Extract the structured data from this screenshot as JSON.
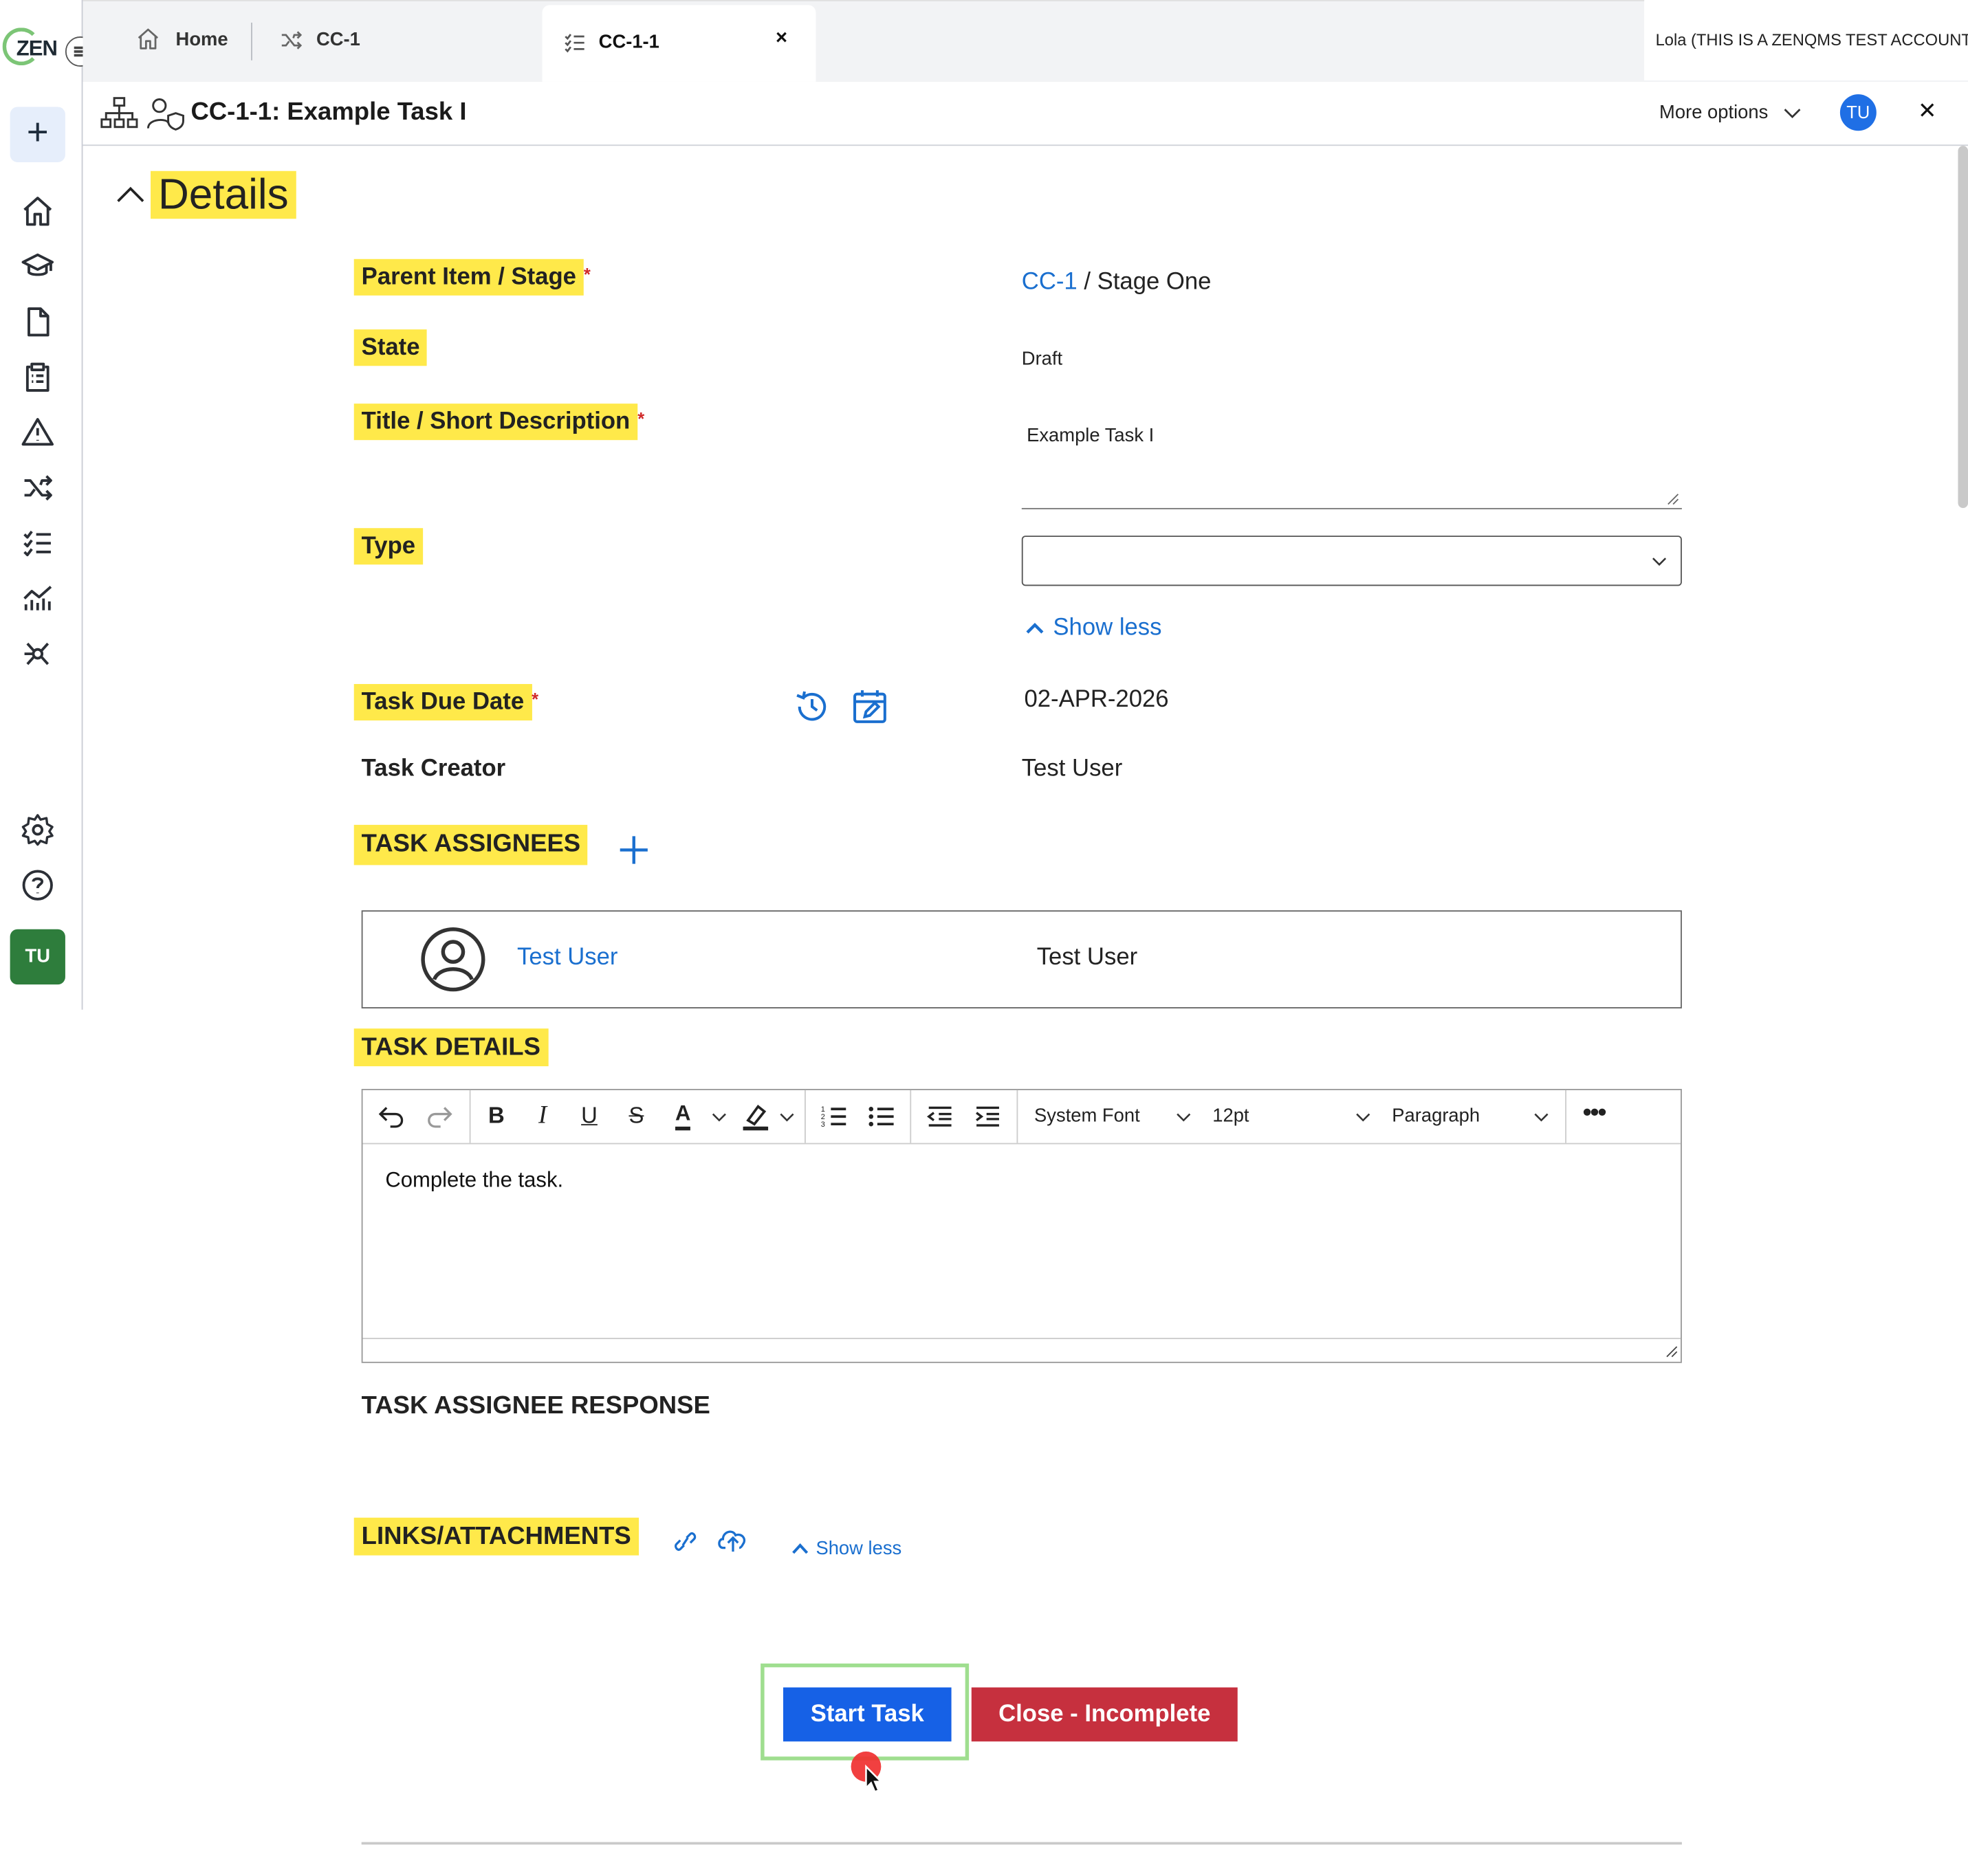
{
  "logo": {
    "text": "ZEN"
  },
  "tabs": [
    {
      "label": "Home",
      "icon": "home-icon"
    },
    {
      "label": "CC-1",
      "icon": "shuffle-icon"
    },
    {
      "label": "CC-1-1",
      "icon": "checklist-icon",
      "active": true
    }
  ],
  "account": {
    "label": "Lola (THIS IS A ZENQMS TEST ACCOUNT)"
  },
  "header": {
    "title": "CC-1-1: Example Task I",
    "more_options": "More options",
    "avatar": "TU"
  },
  "rail": {
    "avatar": "TU"
  },
  "section": {
    "title": "Details"
  },
  "fields": {
    "parent_label": "Parent Item / Stage",
    "parent_link": "CC-1",
    "parent_rest": " / Stage One",
    "state_label": "State",
    "state_value": "Draft",
    "title_label": "Title / Short Description",
    "title_value": "Example Task I",
    "type_label": "Type",
    "type_value": "",
    "show_less": "Show less",
    "due_label": "Task Due Date",
    "due_value": "02-APR-2026",
    "creator_label": "Task Creator",
    "creator_value": "Test User",
    "required_mark": "*"
  },
  "assignees": {
    "heading": "TASK ASSIGNEES",
    "rows": [
      {
        "name_link": "Test User",
        "name": "Test User"
      }
    ]
  },
  "task_details": {
    "heading": "TASK DETAILS",
    "font": "System Font",
    "size": "12pt",
    "block": "Paragraph",
    "body": "Complete the task."
  },
  "response": {
    "heading": "TASK ASSIGNEE RESPONSE"
  },
  "links": {
    "heading": "LINKS/ATTACHMENTS",
    "show_less": "Show less"
  },
  "actions": {
    "start": "Start Task",
    "close": "Close - Incomplete"
  },
  "colors": {
    "highlight": "#ffe94a",
    "link": "#1a6fcf",
    "primary": "#1661e6",
    "danger": "#c6303e",
    "rail_avatar": "#2e7d3c"
  }
}
